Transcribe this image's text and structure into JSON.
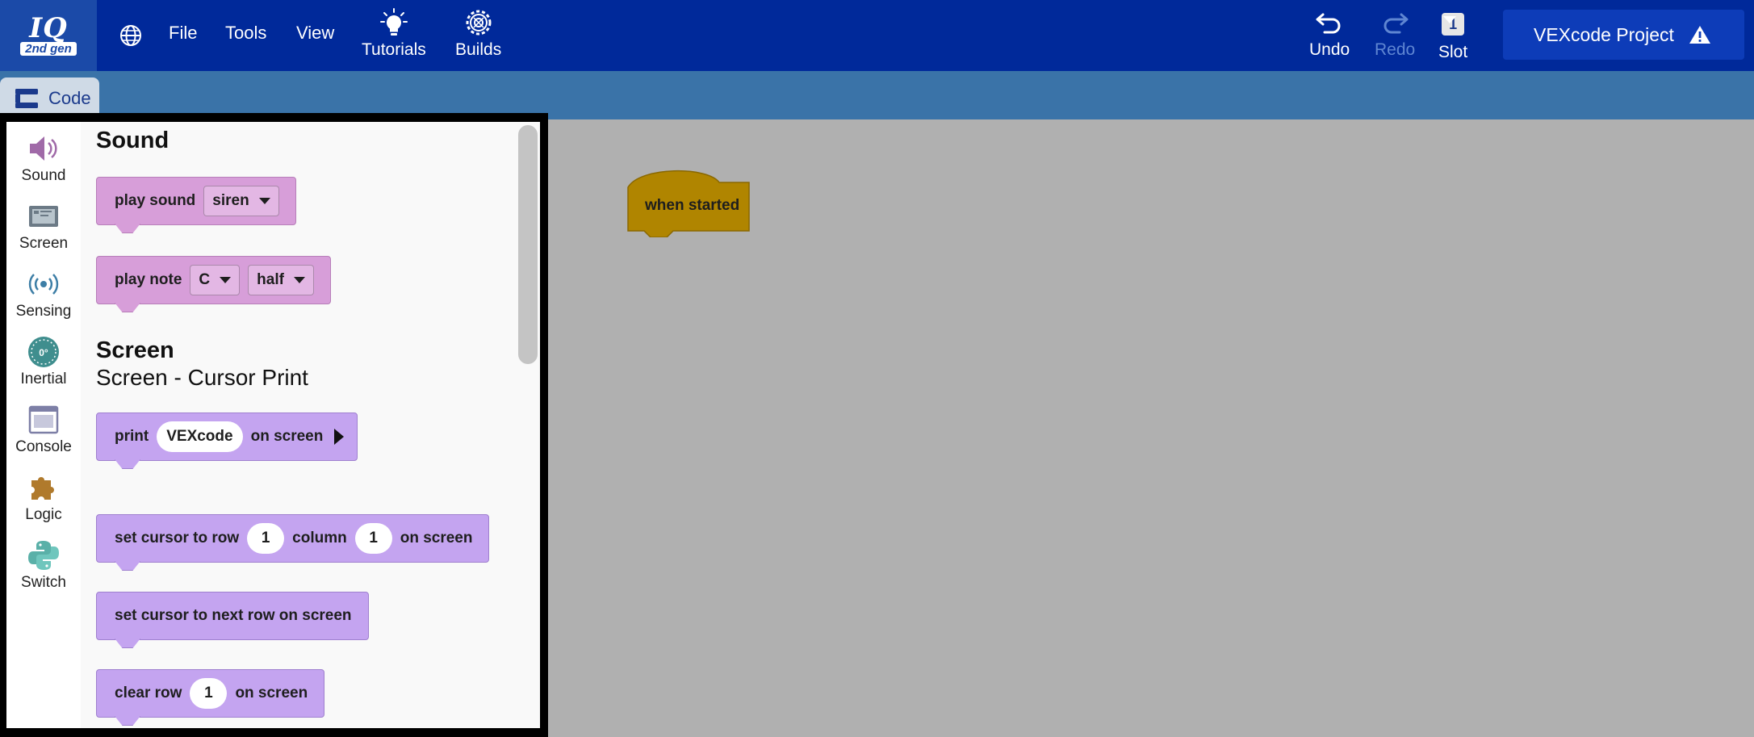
{
  "topbar": {
    "logo_main": "IQ",
    "logo_sub": "2nd gen",
    "globe_icon": "globe-icon",
    "menus": [
      "File",
      "Tools",
      "View"
    ],
    "tutorials_label": "Tutorials",
    "builds_label": "Builds",
    "undo_label": "Undo",
    "redo_label": "Redo",
    "slot_number": "1",
    "slot_label": "Slot",
    "project_name": "VEXcode Project",
    "colors": {
      "bar": "#00299a",
      "project_box": "#0d3cb8",
      "disabled": "#5f86d2"
    }
  },
  "tabs": {
    "code_label": "Code"
  },
  "toolbox": {
    "categories": [
      {
        "label": "Sound",
        "icon": "speaker-icon"
      },
      {
        "label": "Screen",
        "icon": "screen-icon"
      },
      {
        "label": "Sensing",
        "icon": "sensing-icon"
      },
      {
        "label": "Inertial",
        "icon": "inertial-icon",
        "icon_text": "0°"
      },
      {
        "label": "Console",
        "icon": "console-icon"
      },
      {
        "label": "Logic",
        "icon": "puzzle-icon"
      },
      {
        "label": "Switch",
        "icon": "python-icon"
      }
    ],
    "sections": {
      "sound_heading": "Sound",
      "screen_heading": "Screen",
      "screen_sub": "Screen - Cursor Print"
    },
    "blocks": {
      "play_sound": {
        "label": "play sound",
        "value": "siren"
      },
      "play_note": {
        "label": "play note",
        "note": "C",
        "duration": "half"
      },
      "print": {
        "label": "print",
        "value": "VEXcode",
        "suffix": "on screen"
      },
      "set_cursor": {
        "label": "set cursor to row",
        "row": "1",
        "mid": "column",
        "column": "1",
        "suffix": "on screen"
      },
      "next_row": {
        "label": "set cursor to next row on screen"
      },
      "clear_row": {
        "label": "clear row",
        "value": "1",
        "suffix": "on screen"
      }
    },
    "colors": {
      "sound_block": "#d79ed9",
      "screen_block": "#c4a4f0"
    }
  },
  "workspace": {
    "hat_block_label": "when started",
    "colors": {
      "background": "#b0b0b0",
      "event_block": "#b08500"
    }
  }
}
